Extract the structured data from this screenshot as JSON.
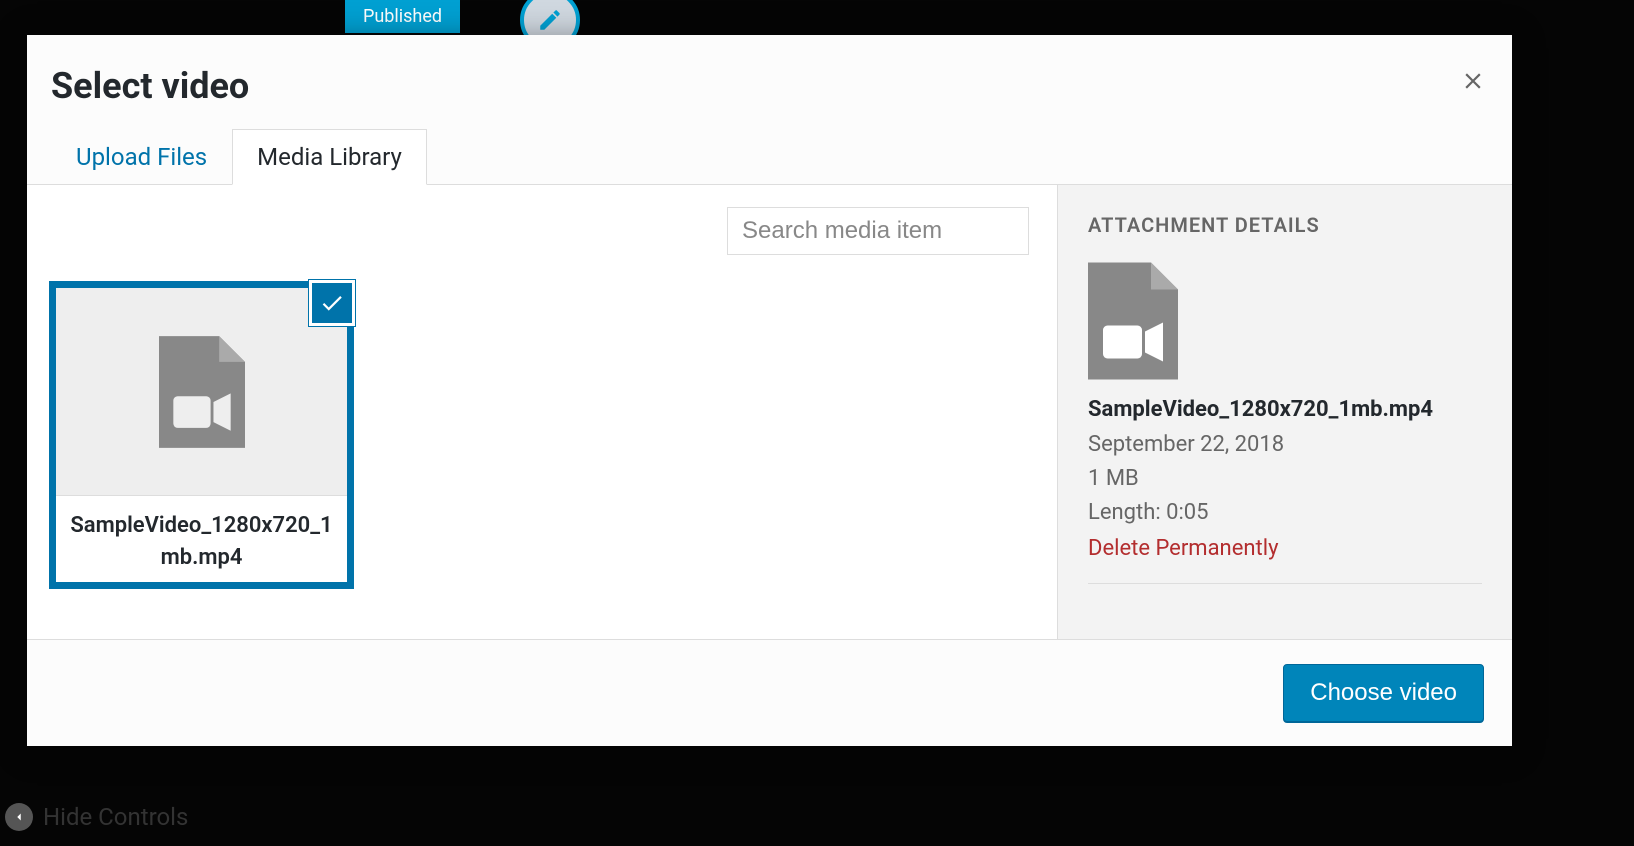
{
  "backdrop": {
    "published": "Published",
    "hideControls": "Hide Controls"
  },
  "modal": {
    "title": "Select video",
    "tabs": {
      "upload": "Upload Files",
      "library": "Media Library"
    },
    "search": {
      "placeholder": "Search media item"
    },
    "items": [
      {
        "name": "SampleVideo_1280x720_1mb.mp4",
        "selected": true
      }
    ],
    "sidebar": {
      "heading": "ATTACHMENT DETAILS",
      "filename": "SampleVideo_1280x720_1mb.mp4",
      "date": "September 22, 2018",
      "size": "1 MB",
      "length": "Length: 0:05",
      "delete": "Delete Permanently"
    },
    "footer": {
      "choose": "Choose video"
    }
  }
}
